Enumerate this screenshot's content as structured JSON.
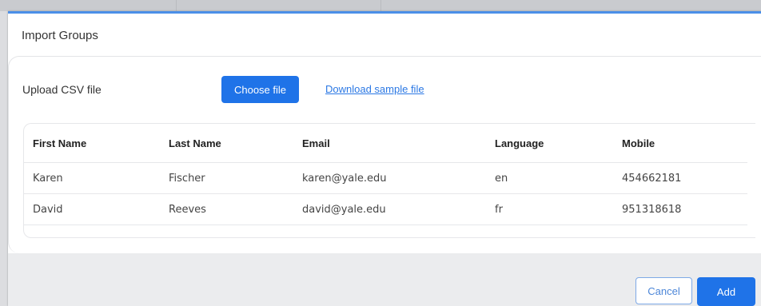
{
  "dialog": {
    "title": "Import Groups",
    "accent_color": "#4b8fe8"
  },
  "upload": {
    "label": "Upload CSV file",
    "choose_button": "Choose file",
    "sample_link": "Download sample file"
  },
  "table": {
    "columns": [
      "First Name",
      "Last Name",
      "Email",
      "Language",
      "Mobile"
    ],
    "rows": [
      [
        "Karen",
        "Fischer",
        "karen@yale.edu",
        "en",
        "454662181"
      ],
      [
        "David",
        "Reeves",
        "david@yale.edu",
        "fr",
        "951318618"
      ]
    ]
  },
  "footer": {
    "cancel_button": "Cancel",
    "add_button": "Add"
  },
  "colors": {
    "primary_button": "#1f73e8",
    "link": "#2b78e4"
  }
}
